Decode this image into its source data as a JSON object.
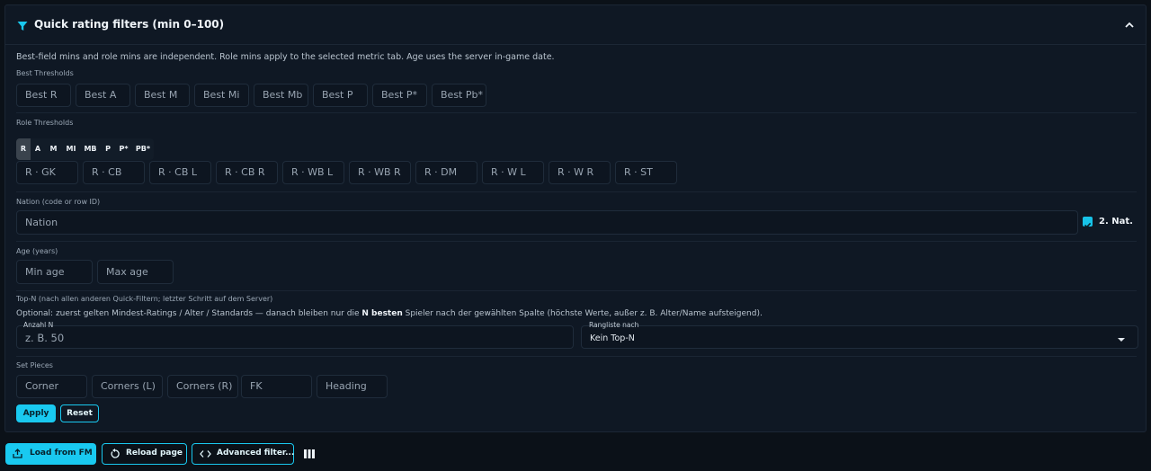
{
  "header": {
    "icon": "filter-icon",
    "title": "Quick rating filters (min 0–100)",
    "collapse_icon": "chevron-up-icon"
  },
  "description": "Best-field mins and role mins are independent. Role mins apply to the selected metric tab. Age uses the server in-game date.",
  "best_thresholds": {
    "label": "Best Thresholds",
    "fields": [
      "Best R",
      "Best A",
      "Best M",
      "Best Mi",
      "Best Mb",
      "Best P",
      "Best P*",
      "Best Pb*"
    ]
  },
  "role_thresholds": {
    "label": "Role Thresholds",
    "tabs": [
      "R",
      "A",
      "M",
      "MI",
      "MB",
      "P",
      "P*",
      "PB*"
    ],
    "active_tab": "R",
    "fields": [
      "R · GK",
      "R · CB",
      "R · CB L",
      "R · CB R",
      "R · WB L",
      "R · WB R",
      "R · DM",
      "R · W L",
      "R · W R",
      "R · ST"
    ]
  },
  "nation": {
    "label": "Nation (code or row ID)",
    "placeholder": "Nation",
    "second_nat_label": "2. Nat.",
    "second_nat_checked": true
  },
  "age": {
    "label": "Age (years)",
    "min_placeholder": "Min age",
    "max_placeholder": "Max age"
  },
  "top_n": {
    "label": "Top-N (nach allen anderen Quick-Filtern; letzter Schritt auf dem Server)",
    "desc_before": "Optional: zuerst gelten Mindest-Ratings / Alter / Standards — danach bleiben nur die ",
    "desc_bold": "N besten",
    "desc_after": " Spieler nach der gewählten Spalte (höchste Werte, außer z. B. Alter/Name aufsteigend).",
    "count_label": "Anzahl N",
    "count_placeholder": "z. B. 50",
    "rank_label": "Rangliste nach",
    "rank_value": "Kein Top-N"
  },
  "set_pieces": {
    "label": "Set Pieces",
    "fields": [
      "Corner",
      "Corners (L)",
      "Corners (R)",
      "FK",
      "Heading"
    ]
  },
  "actions": {
    "apply": "Apply",
    "reset": "Reset"
  },
  "footer": {
    "load_label": "Load from FM",
    "load_icon": "upload-icon",
    "reload_label": "Reload page",
    "reload_icon": "reload-icon",
    "advanced_label": "Advanced filter...",
    "advanced_icon": "code-icon",
    "columns_icon": "columns-icon"
  },
  "colors": {
    "accent": "#19c9f0",
    "panel_bg": "#0f1824",
    "page_bg": "#0b1118"
  }
}
